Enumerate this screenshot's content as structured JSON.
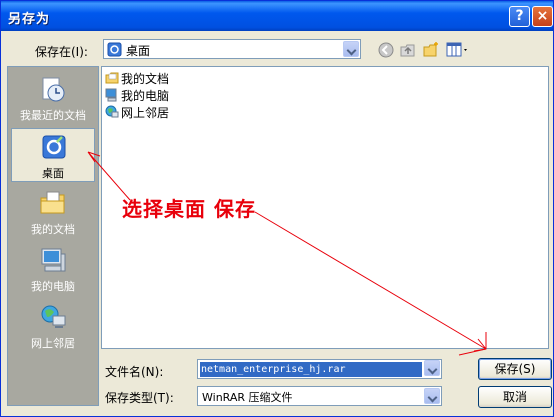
{
  "window": {
    "title": "另存为",
    "help": "?",
    "close": "×"
  },
  "save_in": {
    "label": "保存在(I):",
    "value": "桌面"
  },
  "places": [
    {
      "label": "我最近的文档",
      "icon": "recent-documents-icon"
    },
    {
      "label": "桌面",
      "icon": "desktop-icon",
      "selected": true
    },
    {
      "label": "我的文档",
      "icon": "my-documents-icon"
    },
    {
      "label": "我的电脑",
      "icon": "my-computer-icon"
    },
    {
      "label": "网上邻居",
      "icon": "network-places-icon"
    }
  ],
  "files": [
    {
      "name": "我的文档",
      "icon": "folder-icon"
    },
    {
      "name": "我的电脑",
      "icon": "computer-icon"
    },
    {
      "name": "网上邻居",
      "icon": "network-icon"
    }
  ],
  "filename": {
    "label": "文件名(N):",
    "value": "netman_enterprise_hj.rar"
  },
  "filetype": {
    "label": "保存类型(T):",
    "value": "WinRAR 压缩文件"
  },
  "buttons": {
    "save": "保存(S)",
    "cancel": "取消"
  },
  "annotation": "选择桌面  保存",
  "colors": {
    "annotation": "#e8000b",
    "title_bar": "#0058ee",
    "selection": "#316ac5"
  }
}
